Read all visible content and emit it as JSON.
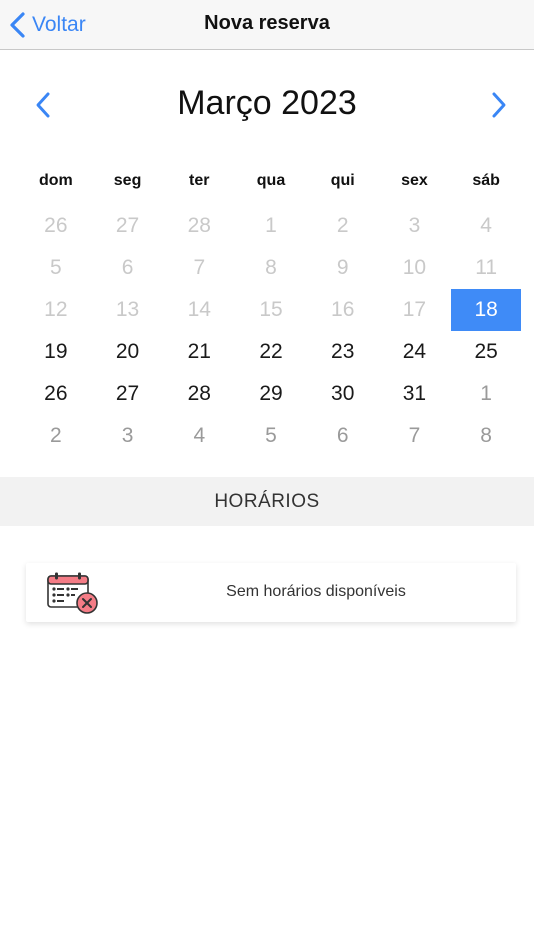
{
  "navbar": {
    "back_label": "Voltar",
    "title": "Nova reserva"
  },
  "calendar": {
    "month_title": "Março 2023",
    "weekdays": [
      "dom",
      "seg",
      "ter",
      "qua",
      "qui",
      "sex",
      "sáb"
    ],
    "days": [
      {
        "label": "26",
        "state": "muted"
      },
      {
        "label": "27",
        "state": "muted"
      },
      {
        "label": "28",
        "state": "muted"
      },
      {
        "label": "1",
        "state": "muted"
      },
      {
        "label": "2",
        "state": "muted"
      },
      {
        "label": "3",
        "state": "muted"
      },
      {
        "label": "4",
        "state": "muted"
      },
      {
        "label": "5",
        "state": "muted"
      },
      {
        "label": "6",
        "state": "muted"
      },
      {
        "label": "7",
        "state": "muted"
      },
      {
        "label": "8",
        "state": "muted"
      },
      {
        "label": "9",
        "state": "muted"
      },
      {
        "label": "10",
        "state": "muted"
      },
      {
        "label": "11",
        "state": "muted"
      },
      {
        "label": "12",
        "state": "muted"
      },
      {
        "label": "13",
        "state": "muted"
      },
      {
        "label": "14",
        "state": "muted"
      },
      {
        "label": "15",
        "state": "muted"
      },
      {
        "label": "16",
        "state": "muted"
      },
      {
        "label": "17",
        "state": "muted"
      },
      {
        "label": "18",
        "state": "selected"
      },
      {
        "label": "19",
        "state": "normal"
      },
      {
        "label": "20",
        "state": "normal"
      },
      {
        "label": "21",
        "state": "normal"
      },
      {
        "label": "22",
        "state": "normal"
      },
      {
        "label": "23",
        "state": "normal"
      },
      {
        "label": "24",
        "state": "normal"
      },
      {
        "label": "25",
        "state": "normal"
      },
      {
        "label": "26",
        "state": "normal"
      },
      {
        "label": "27",
        "state": "normal"
      },
      {
        "label": "28",
        "state": "normal"
      },
      {
        "label": "29",
        "state": "normal"
      },
      {
        "label": "30",
        "state": "normal"
      },
      {
        "label": "31",
        "state": "normal"
      },
      {
        "label": "1",
        "state": "next-month"
      },
      {
        "label": "2",
        "state": "next-month"
      },
      {
        "label": "3",
        "state": "next-month"
      },
      {
        "label": "4",
        "state": "next-month"
      },
      {
        "label": "5",
        "state": "next-month"
      },
      {
        "label": "6",
        "state": "next-month"
      },
      {
        "label": "7",
        "state": "next-month"
      },
      {
        "label": "8",
        "state": "next-month"
      }
    ]
  },
  "schedule": {
    "section_title": "HORÁRIOS",
    "empty_message": "Sem horários disponíveis",
    "empty_icon": "calendar-x-icon"
  },
  "colors": {
    "accent": "#3f8bf7",
    "link": "#3a86f5",
    "muted": "#c9c9c9",
    "danger": "#f47c86"
  }
}
